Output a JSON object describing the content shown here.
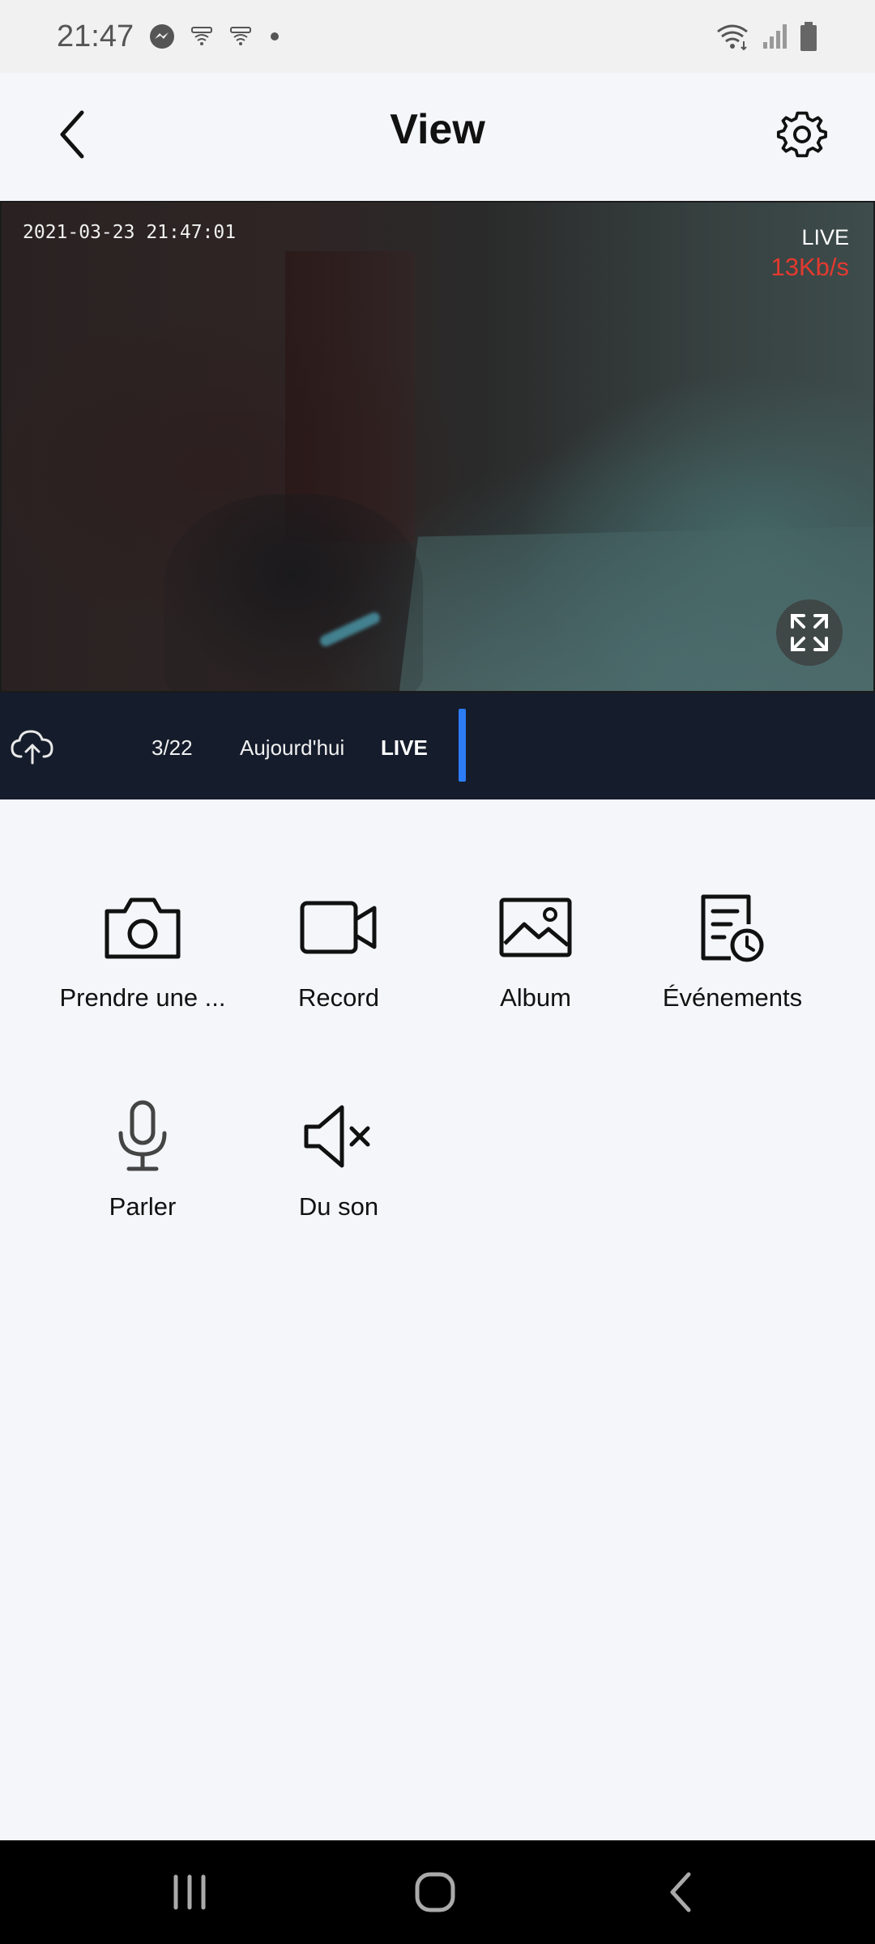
{
  "status_bar": {
    "time": "21:47",
    "left_icons": [
      "messenger-icon",
      "notification-icon",
      "notification-icon",
      "dot-icon"
    ],
    "right_icons": [
      "wifi-icon",
      "signal-icon",
      "battery-icon"
    ]
  },
  "header": {
    "title": "View",
    "back_icon": "chevron-left-icon",
    "settings_icon": "gear-icon"
  },
  "video": {
    "timestamp": "2021-03-23 21:47:01",
    "live_label": "LIVE",
    "bitrate": "13Kb/s",
    "fullscreen_icon": "expand-icon"
  },
  "timeline": {
    "cloud_icon": "cloud-upload-icon",
    "date": "3/22",
    "day": "Aujourd'hui",
    "live": "LIVE",
    "marker_color": "#2c7cf6"
  },
  "actions": [
    {
      "label": "Prendre une ...",
      "icon": "camera-icon"
    },
    {
      "label": "Record",
      "icon": "video-camera-icon"
    },
    {
      "label": "Album",
      "icon": "image-icon"
    },
    {
      "label": "Événements",
      "icon": "event-clock-icon"
    },
    {
      "label": "Parler",
      "icon": "microphone-icon"
    },
    {
      "label": "Du son",
      "icon": "speaker-muted-icon"
    }
  ],
  "nav_bar": {
    "icons": [
      "recent-apps-icon",
      "home-icon",
      "back-icon"
    ]
  },
  "colors": {
    "background": "#f5f6fa",
    "timeline_bg": "#151c2b",
    "bitrate": "#e33a2f",
    "accent": "#2c7cf6"
  }
}
